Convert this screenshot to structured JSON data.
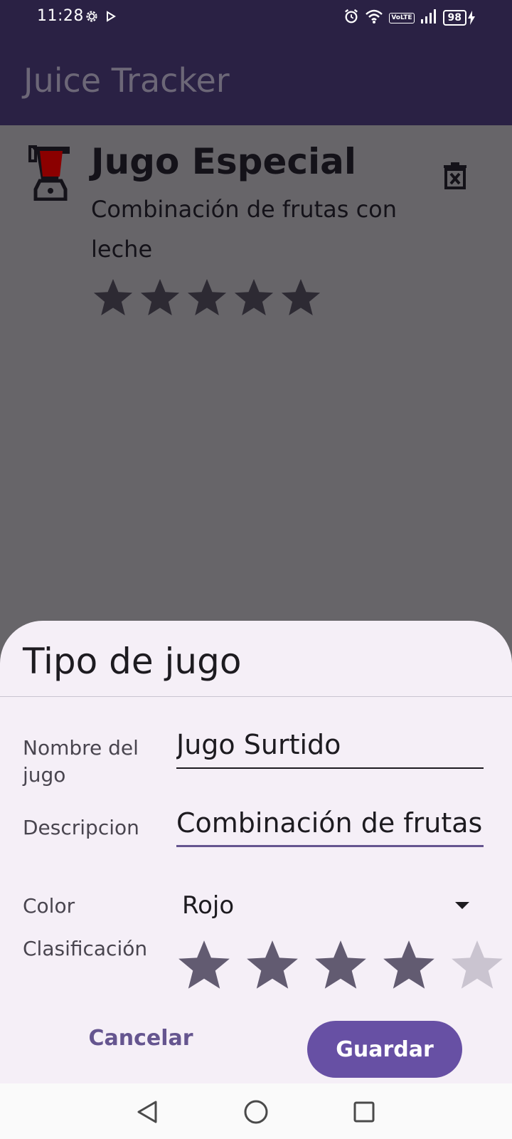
{
  "status_bar": {
    "time": "11:28",
    "network": "VoLTE",
    "battery": "98"
  },
  "app_bar": {
    "title": "Juice Tracker"
  },
  "juice_list": [
    {
      "name": "Jugo Especial",
      "description": "Combinación de frutas con leche",
      "rating": 5,
      "max_rating": 5,
      "icon": "blender-icon",
      "icon_color": "#8b0000"
    }
  ],
  "bottom_sheet": {
    "title": "Tipo de jugo",
    "fields": {
      "name_label": "Nombre del jugo",
      "name_value": "Jugo Surtido",
      "description_label": "Descripcion",
      "description_value": "Combinación de frutas",
      "color_label": "Color",
      "color_value": "Rojo",
      "rating_label": "Clasificación",
      "rating_value": 4,
      "rating_max": 5
    },
    "cancel_label": "Cancelar",
    "save_label": "Guardar"
  },
  "colors": {
    "app_bar": "#2a2144",
    "scrim": "#676569",
    "sheet_bg": "#f5eff7",
    "primary": "#6750a4",
    "star_filled": "#625b71",
    "star_empty": "#cac4d0"
  },
  "nav": {
    "icons": [
      "back-icon",
      "home-icon",
      "recents-icon"
    ]
  }
}
